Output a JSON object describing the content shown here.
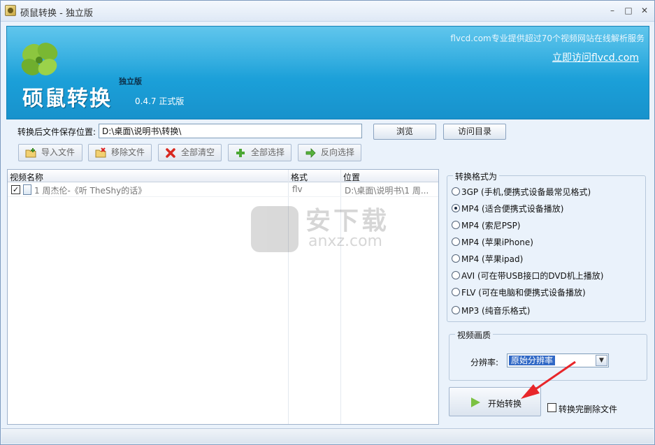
{
  "window": {
    "title": "硕鼠转换 - 独立版",
    "minimize_label": "–",
    "maximize_label": "□",
    "close_label": "✕"
  },
  "banner": {
    "brand": "硕鼠转换",
    "edition": "独立版",
    "version": "0.4.7  正式版",
    "service_text": "flvcd.com专业提供超过70个视频网站在线解析服务",
    "link_text": "立即访问flvcd.com",
    "logo_icon": "clover-leaf-icon"
  },
  "save": {
    "label": "转换后文件保存位置:",
    "path": "D:\\桌面\\说明书\\转换\\",
    "browse_label": "浏览",
    "open_dir_label": "访问目录"
  },
  "toolbar": {
    "import_label": "导入文件",
    "remove_label": "移除文件",
    "clear_label": "全部清空",
    "select_all_label": "全部选择",
    "invert_label": "反向选择"
  },
  "file_list": {
    "headers": {
      "name": "视频名称",
      "format": "格式",
      "location": "位置"
    },
    "rows": [
      {
        "checked": true,
        "name": "1 周杰伦-《听 TheShy的话》",
        "format": "flv",
        "location": "D:\\桌面\\说明书\\1 周..."
      }
    ]
  },
  "format_group": {
    "title": "转换格式为",
    "selected_index": 1,
    "options": [
      "3GP (手机,便携式设备最常见格式)",
      "MP4 (适合便携式设备播放)",
      "MP4 (索尼PSP)",
      "MP4 (苹果iPhone)",
      "MP4 (苹果ipad)",
      "AVI  (可在带USB接口的DVD机上播放)",
      "FLV  (可在电脑和便携式设备播放)",
      "MP3 (纯音乐格式)"
    ]
  },
  "quality_group": {
    "title": "视频画质",
    "resolution_label": "分辨率:",
    "resolution_value": "原始分辨率"
  },
  "actions": {
    "start_label": "开始转换",
    "delete_after_label": "转换完删除文件",
    "delete_after_checked": false
  },
  "watermark": {
    "text_main": "安下载",
    "text_sub": "anxz.com"
  },
  "colors": {
    "banner_blue": "#1b9fd8",
    "accent_arrow": "#e8262a",
    "selection_blue": "#3169c6"
  }
}
